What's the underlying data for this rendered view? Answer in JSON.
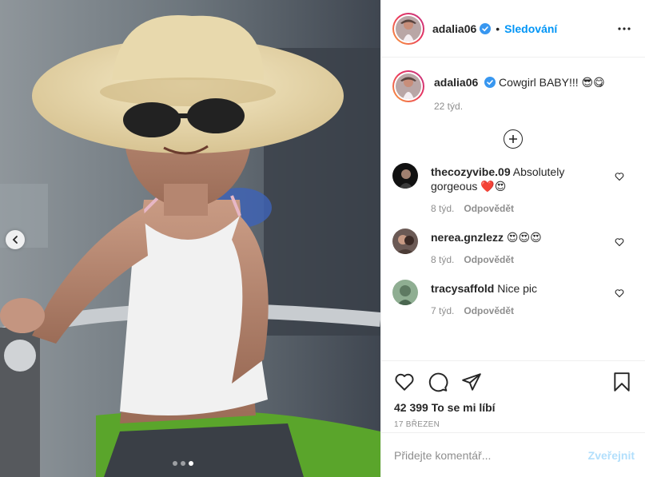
{
  "post": {
    "username": "adalia06",
    "follow_separator": "•",
    "follow_label": "Sledování",
    "caption_text": "Cowgirl BABY!!! 😎😋",
    "caption_age": "22 týd."
  },
  "comments": [
    {
      "user": "thecozyvibe.09",
      "text": "Absolutely gorgeous ❤️😍",
      "age": "8 týd.",
      "reply": "Odpovědět"
    },
    {
      "user": "nerea.gnzlezz",
      "text": "😍😍😍",
      "age": "8 týd.",
      "reply": "Odpovědět"
    },
    {
      "user": "tracysaffold",
      "text": "Nice pic",
      "age": "7 týd.",
      "reply": "Odpovědět"
    }
  ],
  "stats": {
    "likes": "42 399 To se mi líbí",
    "date": "17 březen"
  },
  "composer": {
    "placeholder": "Přidejte komentář...",
    "post_label": "Zveřejnit"
  },
  "colors": {
    "accent": "#0095f6",
    "post_disabled": "#b2dffc",
    "meta": "#8e8e8e",
    "text": "#262626"
  },
  "icons": [
    "chevron-left-icon",
    "verified-badge-icon",
    "more-icon",
    "plus-circle-icon",
    "heart-icon",
    "comment-icon",
    "share-icon",
    "bookmark-icon"
  ],
  "carousel": {
    "total_slides": 3,
    "active_index": 2
  }
}
